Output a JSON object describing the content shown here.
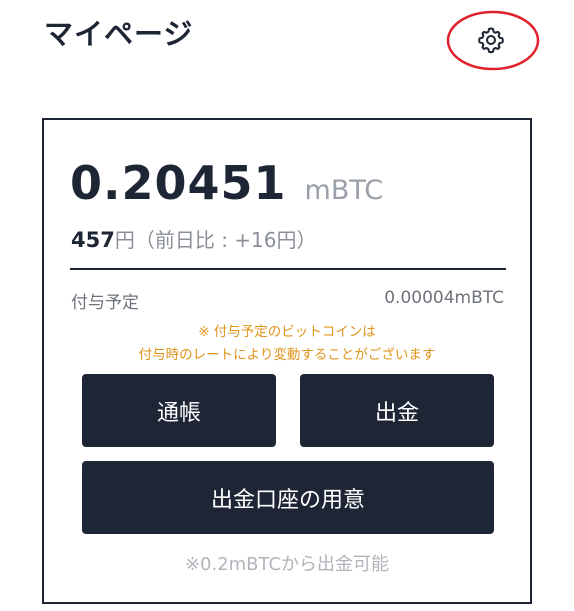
{
  "header": {
    "title": "マイページ"
  },
  "balance": {
    "value": "0.20451",
    "unit": "mBTC",
    "yen_value": "457",
    "yen_rest": "円（前日比 : +16円）"
  },
  "pending": {
    "label": "付与予定",
    "value": "0.00004mBTC",
    "note_line1": "※ 付与予定のビットコインは",
    "note_line2": "付与時のレートにより変動することがございます"
  },
  "buttons": {
    "passbook": "通帳",
    "withdraw": "出金",
    "prepare_account": "出金口座の用意"
  },
  "footer_note": "※0.2mBTCから出金可能",
  "colors": {
    "navy": "#1e2535",
    "note_orange": "#e0941c",
    "highlight_red": "#e0202a"
  }
}
